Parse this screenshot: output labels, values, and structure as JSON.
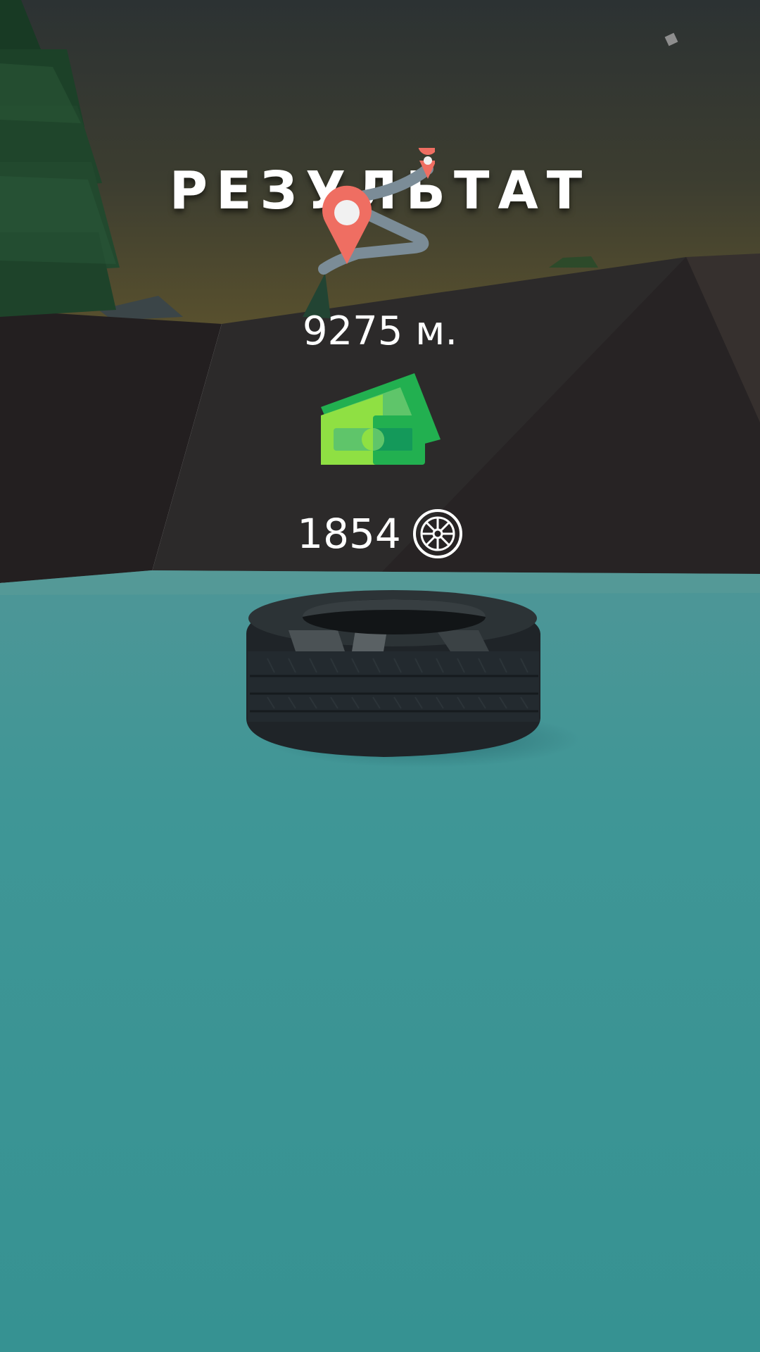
{
  "results": {
    "title": "РЕЗУЛЬТАТ",
    "distance": "9275 м.",
    "coins": "1854"
  },
  "icons": {
    "route": "route-map-pin-icon",
    "money": "cash-stack-icon",
    "coin": "wheel-coin-icon",
    "corner": "diamond-icon"
  },
  "colors": {
    "sky_top": "#2f3433",
    "sky_horizon": "#4e4a2e",
    "cliff": "#2b2829",
    "ground": "#3a9494",
    "pin": "#ef6e62",
    "route": "#7b8c97",
    "money_light": "#8fe043",
    "money_dark": "#22b050"
  }
}
